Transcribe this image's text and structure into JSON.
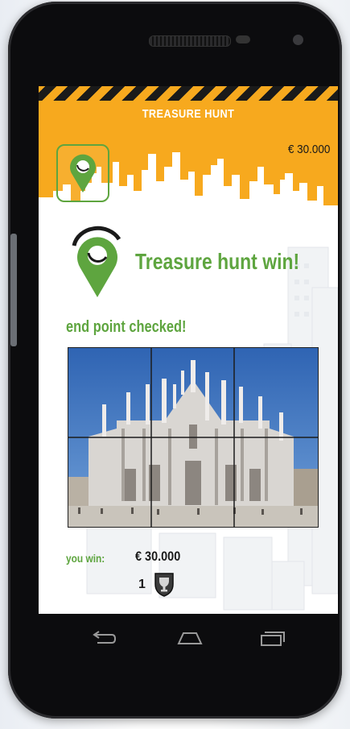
{
  "header": {
    "title": "TREASURE HUNT",
    "balance": "€ 30.000"
  },
  "result": {
    "title": "Treasure hunt win!",
    "subtitle": "end point checked!",
    "win_label": "you win:",
    "win_amount": "€ 30.000",
    "trophy_count": "1"
  },
  "colors": {
    "brand_orange": "#f7a91e",
    "brand_green": "#5ea53f"
  },
  "icons": {
    "header_pin": "map-pin-icon",
    "result_pin": "map-pin-icon",
    "trophy": "trophy-icon",
    "back": "back-icon",
    "home": "home-icon",
    "recents": "recents-icon"
  }
}
